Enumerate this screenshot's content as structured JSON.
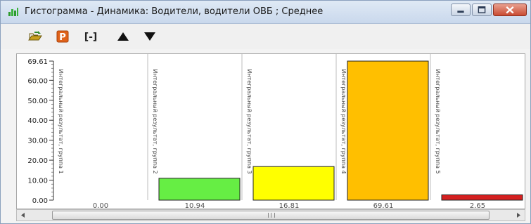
{
  "window": {
    "title": "Гистограмма - Динамика: Водители, водители ОВБ ; Среднее"
  },
  "toolbar": {
    "buttons": [
      {
        "name": "open-icon"
      },
      {
        "name": "report-p-icon",
        "label": "P"
      },
      {
        "name": "fit-range-icon",
        "label": "[-]"
      },
      {
        "name": "up-arrow-icon"
      },
      {
        "name": "down-arrow-icon"
      }
    ]
  },
  "scrollbar": {
    "grip": "III"
  },
  "chart_data": {
    "type": "bar",
    "title": "",
    "xlabel": "",
    "ylabel": "",
    "ylim": [
      0,
      69.61
    ],
    "y_ticks": [
      "69.61",
      "60.00",
      "50.00",
      "40.00",
      "30.00",
      "20.00",
      "10.00",
      "0.00"
    ],
    "categories": [
      "Интегральный результат, группа 1",
      "Интегральный результат, группа 2",
      "Интегральный результат, группа 3",
      "Интегральный результат, группа 4",
      "Интегральный результат, группа 5"
    ],
    "values": [
      0.0,
      10.94,
      16.81,
      69.61,
      2.65
    ],
    "value_labels": [
      "0.00",
      "10.94",
      "16.81",
      "69.61",
      "2.65"
    ],
    "colors": [
      "#ffffff",
      "#66ee44",
      "#ffff00",
      "#ffbf00",
      "#d42020"
    ],
    "grid": false
  }
}
